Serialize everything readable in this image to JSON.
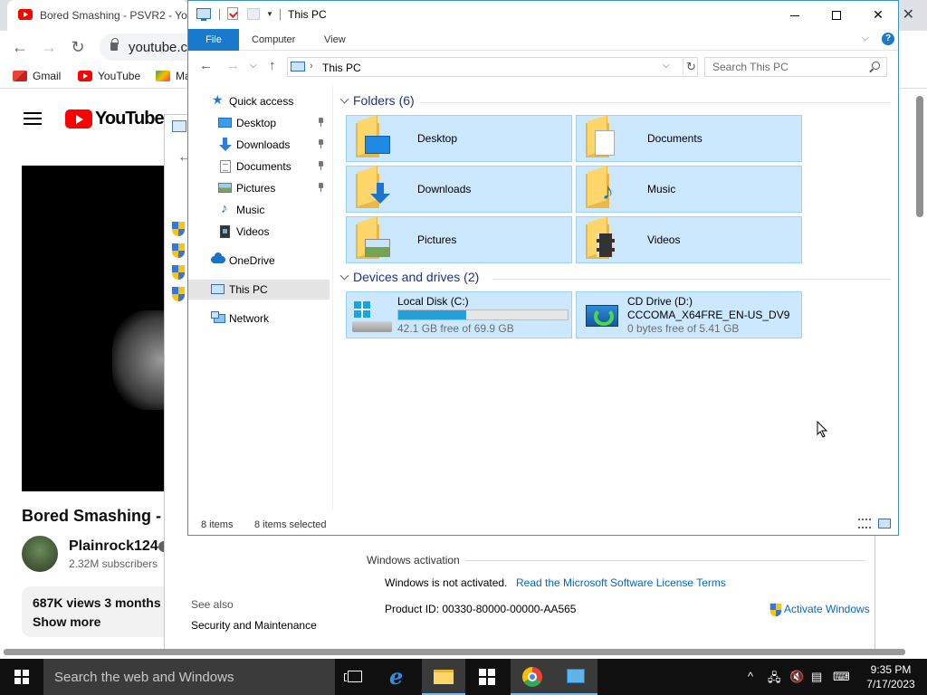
{
  "chrome": {
    "tab_title": "Bored Smashing - PSVR2 - Yo",
    "url": "youtube.co",
    "bookmarks": [
      "Gmail",
      "YouTube",
      "Ma"
    ]
  },
  "youtube": {
    "logo_text": "YouTube",
    "video_title": "Bored Smashing - P",
    "channel": "Plainrock124",
    "subscribers": "2.32M subscribers",
    "views": "687K views  3 months a",
    "show_more": "Show more"
  },
  "security": {
    "activation_title": "Windows activation",
    "activation_status": "Windows is not activated.",
    "license_link": "Read the Microsoft Software License Terms",
    "product_id": "Product ID:  00330-80000-00000-AA565",
    "activate_link": "Activate Windows",
    "see_also": "See also",
    "security_maintenance": "Security and Maintenance"
  },
  "explorer": {
    "title": "This PC",
    "ribbon_tabs": [
      "File",
      "Computer",
      "View"
    ],
    "address": "This PC",
    "search_placeholder": "Search This PC",
    "nav": [
      {
        "label": "Quick access"
      },
      {
        "label": "Desktop"
      },
      {
        "label": "Downloads"
      },
      {
        "label": "Documents"
      },
      {
        "label": "Pictures"
      },
      {
        "label": "Music"
      },
      {
        "label": "Videos"
      },
      {
        "label": "OneDrive"
      },
      {
        "label": "This PC"
      },
      {
        "label": "Network"
      }
    ],
    "folders_header": "Folders (6)",
    "folders": [
      "Desktop",
      "Documents",
      "Downloads",
      "Music",
      "Pictures",
      "Videos"
    ],
    "drives_header": "Devices and drives (2)",
    "drives": [
      {
        "name": "Local Disk (C:)",
        "free": "42.1 GB free of 69.9 GB",
        "used_fraction": 0.4
      },
      {
        "name": "CD Drive (D:)",
        "label": "CCCOMA_X64FRE_EN-US_DV9",
        "free": "0 bytes free of 5.41 GB"
      }
    ],
    "status_count": "8 items",
    "status_selected": "8 items selected",
    "accent": "#1979ca",
    "selection_color": "#cce8ff"
  },
  "taskbar": {
    "search_text": "Search the web and Windows",
    "time": "9:35 PM",
    "date": "7/17/2023"
  }
}
